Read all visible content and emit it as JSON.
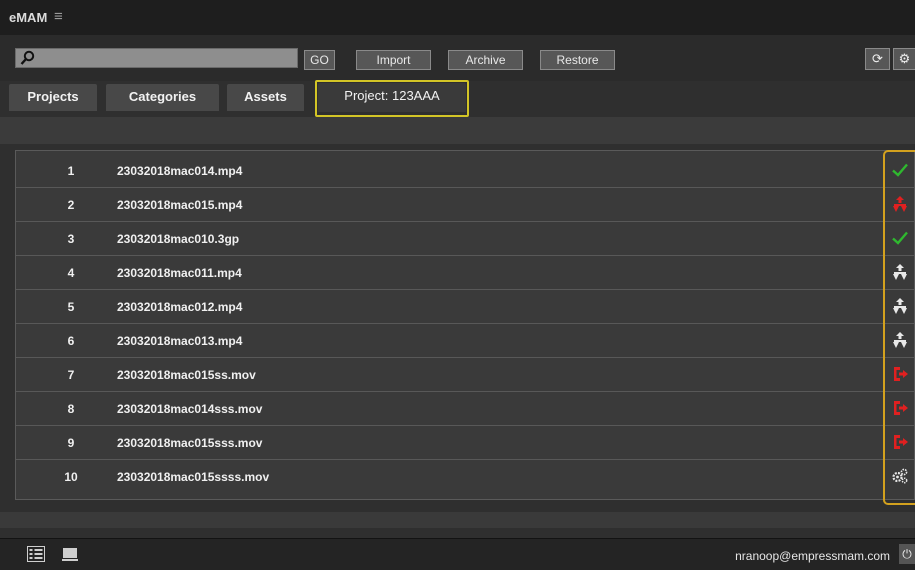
{
  "app": {
    "title": "eMAM",
    "menu_icon": "hamburger-icon"
  },
  "toolbar": {
    "search_value": "",
    "go_label": "GO",
    "import_label": "Import",
    "archive_label": "Archive",
    "restore_label": "Restore",
    "refresh_icon": "refresh-icon",
    "settings_icon": "gear-icon"
  },
  "tabs": [
    {
      "label": "Projects"
    },
    {
      "label": "Categories"
    },
    {
      "label": "Assets"
    },
    {
      "label": "Project: 123AAA"
    }
  ],
  "rows": [
    {
      "num": "1",
      "name": "23032018mac014.mp4",
      "status": "check"
    },
    {
      "num": "2",
      "name": "23032018mac015.mp4",
      "status": "proxy-red"
    },
    {
      "num": "3",
      "name": "23032018mac010.3gp",
      "status": "check"
    },
    {
      "num": "4",
      "name": "23032018mac011.mp4",
      "status": "proxy-white"
    },
    {
      "num": "5",
      "name": "23032018mac012.mp4",
      "status": "proxy-white"
    },
    {
      "num": "6",
      "name": "23032018mac013.mp4",
      "status": "proxy-white"
    },
    {
      "num": "7",
      "name": "23032018mac015ss.mov",
      "status": "export-red"
    },
    {
      "num": "8",
      "name": "23032018mac014sss.mov",
      "status": "export-red"
    },
    {
      "num": "9",
      "name": "23032018mac015sss.mov",
      "status": "export-red"
    },
    {
      "num": "10",
      "name": "23032018mac015ssss.mov",
      "status": "gears"
    }
  ],
  "footer": {
    "user": "nranoop@empressmam.com",
    "power_glyph": "⏻"
  },
  "colors": {
    "highlight": "#d3c526",
    "success": "#2fb82f",
    "error": "#e02020"
  }
}
